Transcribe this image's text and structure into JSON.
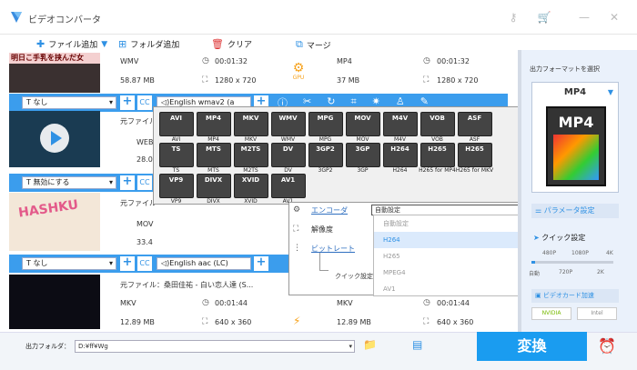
{
  "app": {
    "title": "ビデオコンバータ"
  },
  "toolbar": {
    "add_file": "ファイル追加",
    "add_folder": "フォルダ追加",
    "clear": "クリア",
    "merge": "マージ"
  },
  "rows": [
    {
      "banner": "明日こ手乳を挟んだ女",
      "src_format": "WMV",
      "src_duration": "00:01:32",
      "src_size": "58.87 MB",
      "src_res": "1280 x 720",
      "dst_format": "MP4",
      "dst_duration": "00:01:32",
      "dst_size": "37 MB",
      "dst_res": "1280 x 720",
      "gpu": "GPU"
    },
    {
      "title": "元ファイル",
      "src_format": "WEBM",
      "src_value": "28.0"
    },
    {
      "title": "元ファイル",
      "src_format": "MOV",
      "src_value": "33.4",
      "thumb_text": "HASHKU"
    },
    {
      "title": "元ファイル：桑田佳祐 - 白い恋人達 (S...",
      "src_format": "MKV",
      "src_duration": "00:01:44",
      "src_size": "12.89 MB",
      "src_res": "640 x 360",
      "dst_format": "MKV",
      "dst_duration": "00:01:44",
      "dst_size": "12.89 MB",
      "dst_res": "640 x 360"
    }
  ],
  "bars": [
    {
      "subtitle": "なし",
      "audio": "English wmav2 (a"
    },
    {
      "subtitle": "無効にする"
    },
    {
      "subtitle": "なし",
      "audio": "English aac (LC)"
    }
  ],
  "formats_row1": [
    {
      "top": "AVI",
      "label": "AVI"
    },
    {
      "top": "MP4",
      "label": "MP4"
    },
    {
      "top": "MKV",
      "label": "MKV"
    },
    {
      "top": "WMV",
      "label": "WMV"
    },
    {
      "top": "MPG",
      "label": "MPG"
    },
    {
      "top": "MOV",
      "label": "MOV"
    },
    {
      "top": "M4V",
      "label": "M4V"
    },
    {
      "top": "VOB",
      "label": "VOB"
    },
    {
      "top": "ASF",
      "label": "ASF"
    },
    {
      "top": "TS",
      "label": "TS"
    }
  ],
  "formats_row2": [
    {
      "top": "MTS",
      "label": "MTS"
    },
    {
      "top": "M2TS",
      "label": "M2TS"
    },
    {
      "top": "DV",
      "label": "DV"
    },
    {
      "top": "3GP2",
      "label": "3GP2"
    },
    {
      "top": "3GP",
      "label": "3GP"
    },
    {
      "top": "H264",
      "label": "H264"
    },
    {
      "top": "H265",
      "label": "H265 for MP4"
    },
    {
      "top": "H265",
      "label": "H265 for MKV"
    },
    {
      "top": "VP9",
      "label": "VP9"
    },
    {
      "top": "DIVX",
      "label": "DIVX"
    }
  ],
  "formats_row3": [
    {
      "top": "XVID",
      "label": "XVID"
    },
    {
      "top": "AV1",
      "label": "AV1"
    }
  ],
  "settings": {
    "encoder": "エンコーダ",
    "resolution": "解像度",
    "bitrate": "ビットレート",
    "quick": "クイック設定",
    "select_value": "自動設定"
  },
  "dropdown": {
    "items": [
      "自動設定",
      "H264",
      "H265",
      "MPEG4",
      "AV1"
    ]
  },
  "sidebar": {
    "select_title": "出力フォーマットを選択",
    "format": "MP4",
    "format_big": "MP4",
    "params": "パラメータ設定",
    "quick": "クイック設定",
    "top_labels": [
      "480P",
      "1080P",
      "4K"
    ],
    "bottom_labels": [
      "自動",
      "720P",
      "2K"
    ],
    "videocard": "ビデオカード加速",
    "nvidia": "NVIDIA",
    "intel": "Intel"
  },
  "footer": {
    "folder_label": "出力フォルダ：",
    "folder_value": "D:¥ff¥Wg",
    "convert": "変換"
  }
}
